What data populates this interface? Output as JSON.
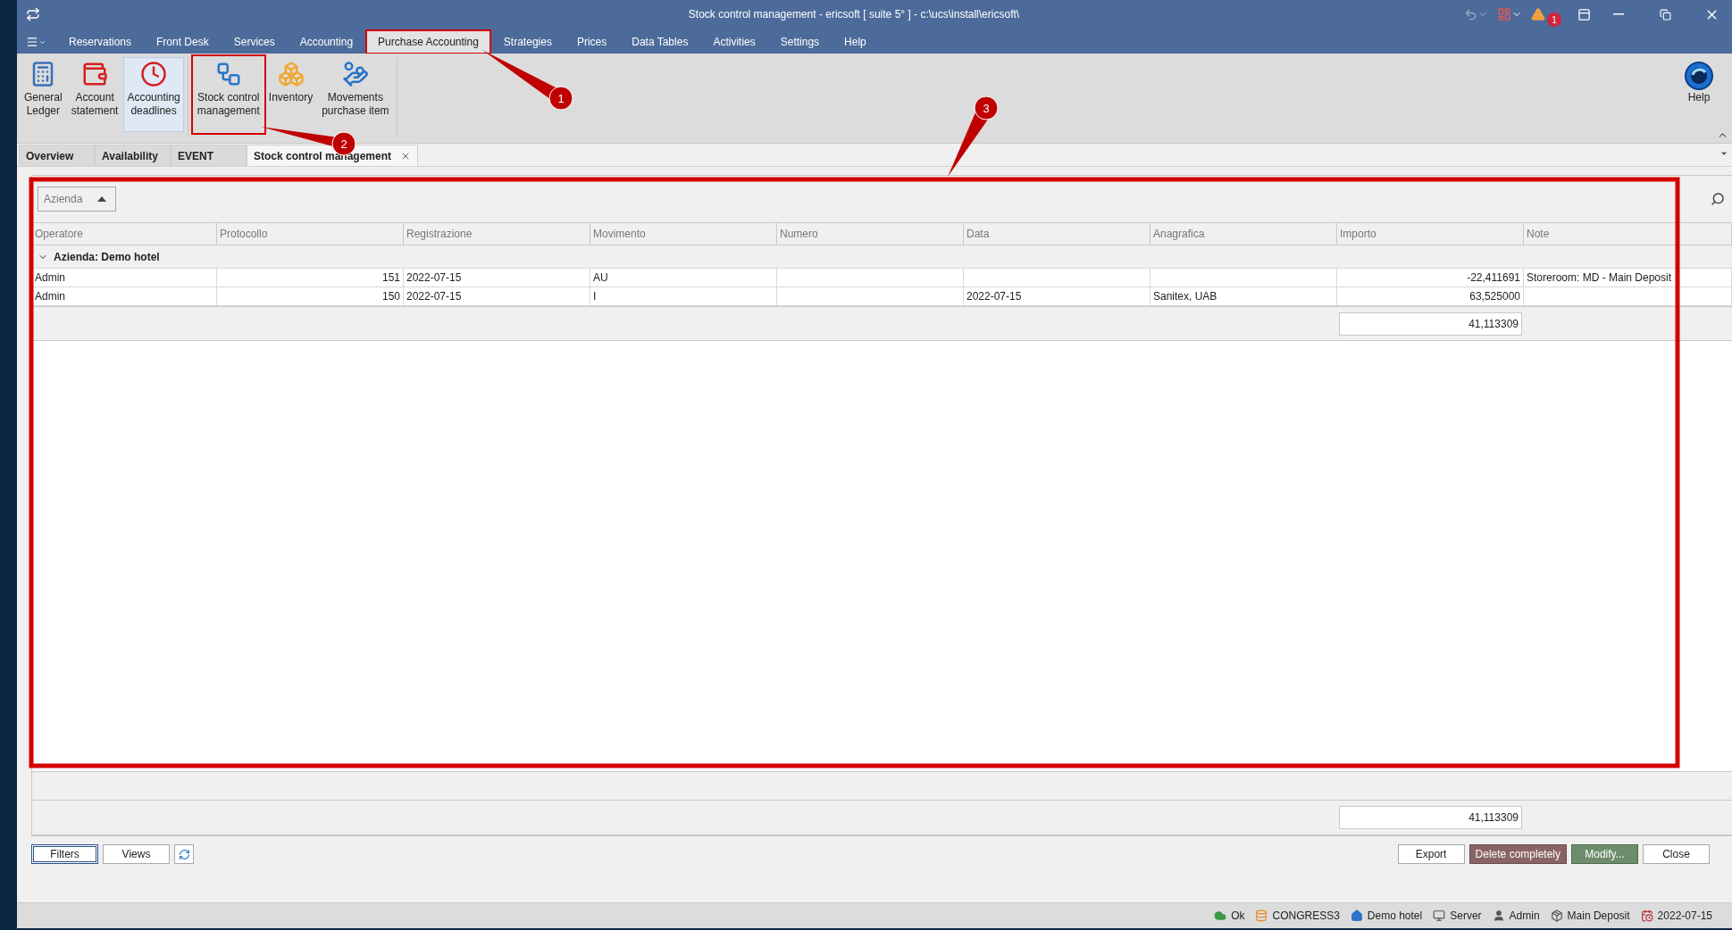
{
  "window": {
    "title": "Stock control management - ericsoft [ suite 5° ] - c:\\ucs\\install\\ericsoft\\",
    "notification_count": "1"
  },
  "menu": [
    {
      "label": "Reservations",
      "selected": false,
      "highlighted": false
    },
    {
      "label": "Front Desk",
      "selected": false,
      "highlighted": false
    },
    {
      "label": "Services",
      "selected": false,
      "highlighted": false
    },
    {
      "label": "Accounting",
      "selected": false,
      "highlighted": false
    },
    {
      "label": "Purchase Accounting",
      "selected": true,
      "highlighted": true
    },
    {
      "label": "Strategies",
      "selected": false,
      "highlighted": false
    },
    {
      "label": "Prices",
      "selected": false,
      "highlighted": false
    },
    {
      "label": "Data Tables",
      "selected": false,
      "highlighted": false
    },
    {
      "label": "Activities",
      "selected": false,
      "highlighted": false
    },
    {
      "label": "Settings",
      "selected": false,
      "highlighted": false
    },
    {
      "label": "Help",
      "selected": false,
      "highlighted": false
    }
  ],
  "ribbon": {
    "items": [
      {
        "lines": [
          "General",
          "Ledger"
        ],
        "selected": false,
        "highlighted": false
      },
      {
        "lines": [
          "Account",
          "statement"
        ],
        "selected": false,
        "highlighted": false
      },
      {
        "lines": [
          "Accounting",
          "deadlines"
        ],
        "selected": true,
        "highlighted": false
      },
      {
        "lines": [
          "Stock control",
          "management"
        ],
        "selected": false,
        "highlighted": true
      },
      {
        "lines": [
          "Inventory"
        ],
        "selected": false,
        "highlighted": false
      },
      {
        "lines": [
          "Movements",
          "purchase item"
        ],
        "selected": false,
        "highlighted": false
      }
    ],
    "help": {
      "label": "Help"
    }
  },
  "doc_tabs": [
    {
      "label": "Overview",
      "selected": false,
      "closable": false
    },
    {
      "label": "Availability",
      "selected": false,
      "closable": false
    },
    {
      "label": "EVENT",
      "selected": false,
      "closable": false
    },
    {
      "label": "Stock control management",
      "selected": true,
      "closable": true
    }
  ],
  "grid": {
    "group_by": "Azienda",
    "columns": [
      "Operatore",
      "Protocollo",
      "Registrazione",
      "Movimento",
      "Numero",
      "Data",
      "Anagrafica",
      "Importo",
      "Note"
    ],
    "group": {
      "label": "Azienda: Demo hotel",
      "expanded": true
    },
    "rows": [
      {
        "cells": [
          "Admin",
          "151",
          "2022-07-15",
          "AU",
          "",
          "",
          "",
          "-22,411691",
          "Storeroom: MD - Main Deposit"
        ]
      },
      {
        "cells": [
          "Admin",
          "150",
          "2022-07-15",
          "I",
          "",
          "2022-07-15",
          "Sanitex, UAB",
          "63,525000",
          ""
        ]
      }
    ],
    "group_total": "41,113309",
    "grand_total": "41,113309"
  },
  "buttons_left": [
    {
      "label": "Filters",
      "focused": true
    },
    {
      "label": "Views",
      "focused": false
    }
  ],
  "buttons_right": [
    {
      "label": "Export",
      "kind": "plain"
    },
    {
      "label": "Delete completely",
      "kind": "danger"
    },
    {
      "label": "Modify...",
      "kind": "confirm"
    },
    {
      "label": "Close",
      "kind": "plain"
    }
  ],
  "status_bar": [
    {
      "label": "Ok"
    },
    {
      "label": "CONGRESS3"
    },
    {
      "label": "Demo hotel"
    },
    {
      "label": "Server"
    },
    {
      "label": "Admin"
    },
    {
      "label": "Main Deposit"
    },
    {
      "label": "2022-07-15"
    }
  ],
  "callouts": [
    {
      "number": "1"
    },
    {
      "number": "2"
    },
    {
      "number": "3"
    }
  ]
}
